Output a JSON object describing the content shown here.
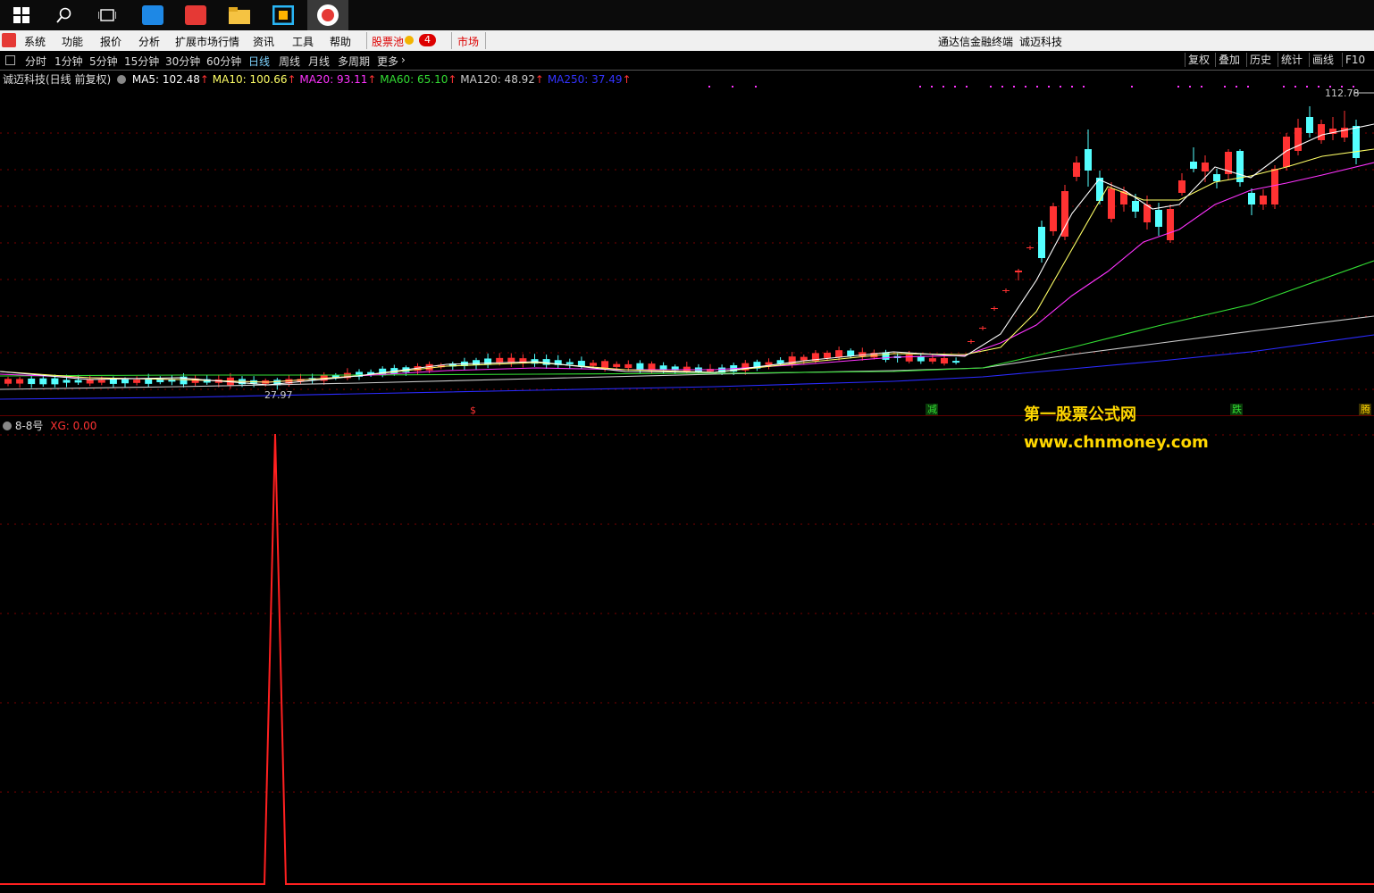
{
  "taskbar": {
    "icons": [
      "windows-start-icon",
      "search-icon",
      "task-view-icon",
      "app-blue-icon",
      "app-red-icon",
      "folder-icon",
      "app-teal-icon",
      "tdx-app-icon"
    ]
  },
  "menubar": {
    "items": [
      "系统",
      "功能",
      "报价",
      "分析",
      "扩展市场行情",
      "资讯",
      "工具",
      "帮助"
    ],
    "pool_label": "股票池",
    "pool_badge": "4",
    "market_label": "市场",
    "window_title": "通达信金融终端",
    "stock_name": "诚迈科技"
  },
  "periodbar": {
    "periods": [
      "分时",
      "1分钟",
      "5分钟",
      "15分钟",
      "30分钟",
      "60分钟",
      "日线",
      "周线",
      "月线",
      "多周期",
      "更多"
    ],
    "active_period": "日线",
    "tools": [
      "复权",
      "叠加",
      "历史",
      "统计",
      "画线",
      "F10"
    ]
  },
  "main_chart": {
    "title": "诚迈科技(日线 前复权)",
    "ma_labels": [
      {
        "text": "MA5: 102.48",
        "color": "#ffffff"
      },
      {
        "text": "MA10: 100.66",
        "color": "#ffff66"
      },
      {
        "text": "MA20: 93.11",
        "color": "#ff33ff"
      },
      {
        "text": "MA60: 65.10",
        "color": "#33dd33"
      },
      {
        "text": "MA120: 48.92",
        "color": "#cccccc"
      },
      {
        "text": "MA250: 37.49",
        "color": "#3333ff"
      }
    ],
    "high_label": "112.78",
    "low_label": "27.97",
    "signals": [
      {
        "text": "$",
        "color": "#ff3333"
      },
      {
        "text": "减",
        "color": "#33dd33"
      },
      {
        "text": "跌",
        "color": "#33dd33"
      },
      {
        "text": "腾",
        "color": "#ffd700"
      }
    ]
  },
  "indicator": {
    "name": "8-8号",
    "value_label": "XG: 0.00"
  },
  "watermark": {
    "line1": "第一股票公式网",
    "line2": "www.chnmoney.com"
  },
  "colors": {
    "up": "#ff3232",
    "down": "#54ffff",
    "grid": "#7a0000"
  }
}
